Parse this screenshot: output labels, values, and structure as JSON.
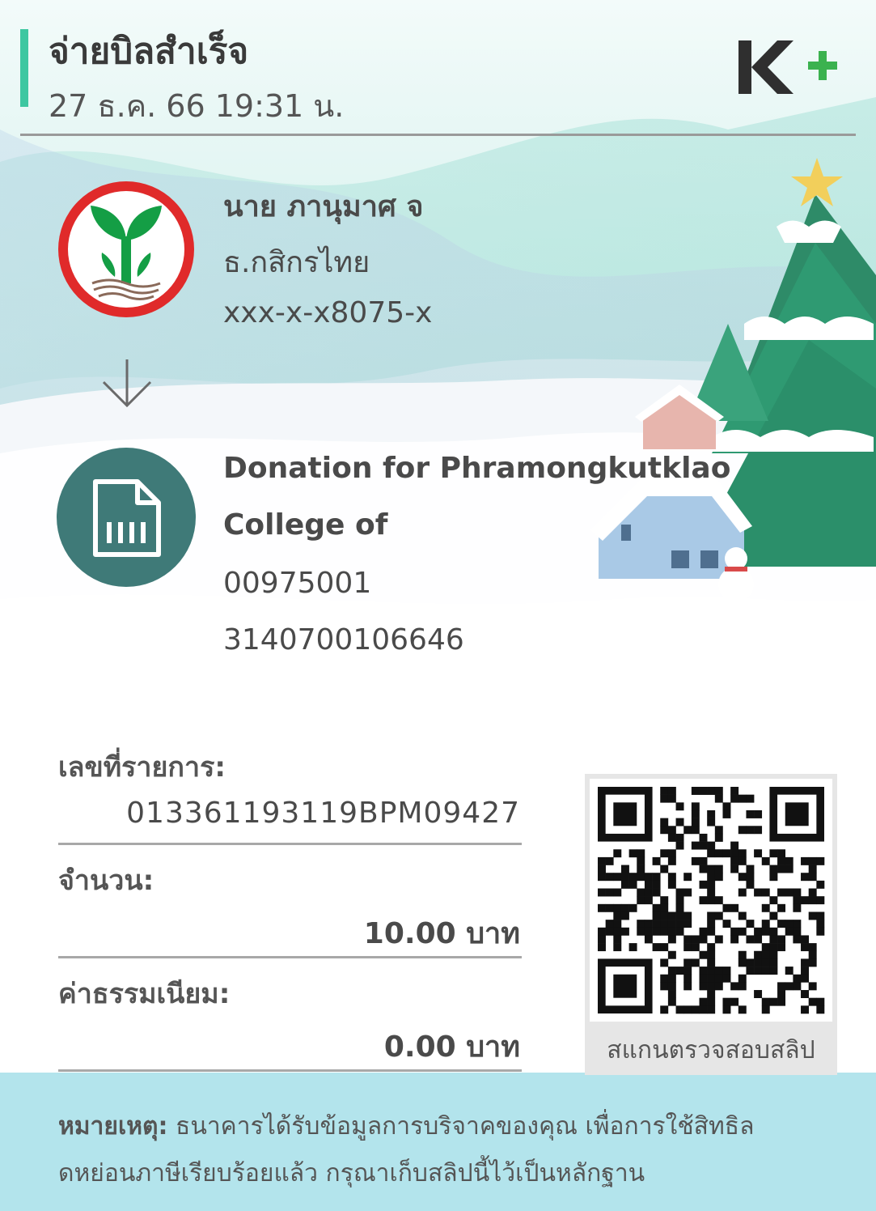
{
  "header": {
    "title": "จ่ายบิลสำเร็จ",
    "datetime": "27 ธ.ค. 66  19:31 น.",
    "brand_logo_text": "K+",
    "accent_color": "#3ec7a1"
  },
  "sender": {
    "name": "นาย ภานุมาศ จ",
    "bank": "ธ.กสิกรไทย",
    "account": "xxx-x-x8075-x",
    "logo_icon": "kbank-logo-icon"
  },
  "transfer_icon": "arrow-down-icon",
  "biller": {
    "icon": "bill-document-icon",
    "lines": [
      "Donation for Phramongkutklao",
      "College of",
      "00975001",
      "3140700106646"
    ]
  },
  "details": {
    "transaction_label": "เลขที่รายการ:",
    "transaction_value": "013361193119BPM09427",
    "amount_label": "จำนวน:",
    "amount_value": "10.00 บาท",
    "fee_label": "ค่าธรรมเนียม:",
    "fee_value": "0.00 บาท"
  },
  "qr": {
    "icon": "qr-code-icon",
    "caption": "สแกนตรวจสอบสลิป"
  },
  "footer": {
    "note_label": "หมายเหตุ:",
    "note_line_1": " ธนาคารได้รับข้อมูลการบริจาคของคุณ เพื่อการใช้สิทธิล",
    "note_line_2": "ดหย่อนภาษีเรียบร้อยแล้ว กรุณาเก็บสลิปนี้ไว้เป็นหลักฐาน",
    "background_color": "#b3e4ec"
  }
}
